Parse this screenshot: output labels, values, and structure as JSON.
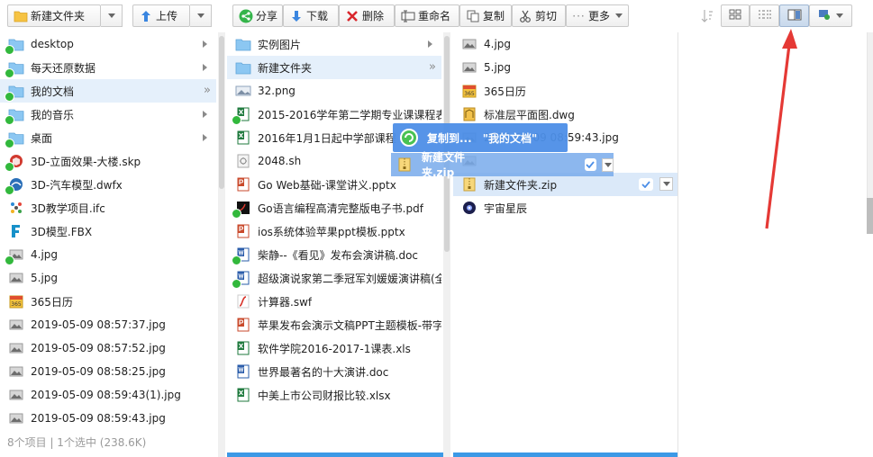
{
  "toolbar": {
    "new_folder": "新建文件夹",
    "upload": "上传",
    "share": "分享",
    "download": "下载",
    "delete": "删除",
    "rename": "重命名",
    "copy": "复制",
    "cut": "剪切",
    "more": "更多"
  },
  "column1": {
    "items": [
      {
        "label": "desktop",
        "icon": "folder-synced-icon"
      },
      {
        "label": "每天还原数据",
        "icon": "folder-synced-icon"
      },
      {
        "label": "我的文档",
        "icon": "folder-synced-icon"
      },
      {
        "label": "我的音乐",
        "icon": "folder-synced-icon"
      },
      {
        "label": "桌面",
        "icon": "folder-synced-icon"
      },
      {
        "label": "3D-立面效果-大楼.skp",
        "icon": "sketchup-file-icon"
      },
      {
        "label": "3D-汽车模型.dwfx",
        "icon": "dwfx-file-icon"
      },
      {
        "label": "3D教学项目.ifc",
        "icon": "ifc-file-icon"
      },
      {
        "label": "3D模型.FBX",
        "icon": "fbx-file-icon"
      },
      {
        "label": "4.jpg",
        "icon": "image-file-icon"
      },
      {
        "label": "5.jpg",
        "icon": "image-file-icon"
      },
      {
        "label": "365日历",
        "icon": "calendar-app-icon"
      },
      {
        "label": "2019-05-09 08:57:37.jpg",
        "icon": "image-file-icon"
      },
      {
        "label": "2019-05-09 08:57:52.jpg",
        "icon": "image-file-icon"
      },
      {
        "label": "2019-05-09 08:58:25.jpg",
        "icon": "image-file-icon"
      },
      {
        "label": "2019-05-09 08:59:43(1).jpg",
        "icon": "image-file-icon"
      },
      {
        "label": "2019-05-09 08:59:43.jpg",
        "icon": "image-file-icon"
      }
    ],
    "status": "8个项目 | 1个选中 (238.6K)"
  },
  "column2": {
    "items": [
      {
        "label": "实例图片",
        "icon": "folder-icon"
      },
      {
        "label": "新建文件夹",
        "icon": "folder-icon"
      },
      {
        "label": "32.png",
        "icon": "png-file-icon"
      },
      {
        "label": "2015-2016学年第二学期专业课课程表",
        "icon": "excel-file-icon"
      },
      {
        "label": "2016年1月1日起中学部课程",
        "icon": "excel-file-icon"
      },
      {
        "label": "2048.sh",
        "icon": "script-file-icon"
      },
      {
        "label": "Go Web基础-课堂讲义.pptx",
        "icon": "ppt-file-icon"
      },
      {
        "label": "Go语言编程高清完整版电子书.pdf",
        "icon": "pdf-file-icon"
      },
      {
        "label": "ios系统体验苹果ppt模板.pptx",
        "icon": "ppt-file-icon"
      },
      {
        "label": "柴静--《看见》发布会演讲稿.doc",
        "icon": "word-file-icon"
      },
      {
        "label": "超级演说家第二季冠军刘媛媛演讲稿(全",
        "icon": "word-file-icon"
      },
      {
        "label": "计算器.swf",
        "icon": "swf-file-icon"
      },
      {
        "label": "苹果发布会演示文稿PPT主题模板-带字",
        "icon": "ppt-file-icon"
      },
      {
        "label": "软件学院2016-2017-1课表.xls",
        "icon": "excel-file-icon"
      },
      {
        "label": "世界最著名的十大演讲.doc",
        "icon": "word-file-icon"
      },
      {
        "label": "中美上市公司财报比较.xlsx",
        "icon": "excel-file-icon"
      }
    ]
  },
  "column3": {
    "items": [
      {
        "label": "4.jpg",
        "icon": "image-file-icon"
      },
      {
        "label": "5.jpg",
        "icon": "image-file-icon"
      },
      {
        "label": "365日历",
        "icon": "calendar-app-icon"
      },
      {
        "label": "标准层平面图.dwg",
        "icon": "dwg-file-icon"
      },
      {
        "label": "2019-05-09 08:59:43.jpg",
        "icon": "image-file-icon"
      },
      {
        "label": "",
        "icon": "image-file-icon"
      },
      {
        "label": "新建文件夹.zip",
        "icon": "zip-file-icon"
      },
      {
        "label": "宇宙星辰",
        "icon": "galaxy-app-icon"
      }
    ]
  },
  "drag": {
    "tooltip_action": "复制到...",
    "tooltip_target": "\"我的文档\"",
    "ghost_label": "新建文件夹.zip"
  },
  "colors": {
    "accent": "#4d8fe7",
    "selection": "#e5f0fb",
    "sync_green": "#32b83c",
    "annotation_red": "#e53935"
  }
}
